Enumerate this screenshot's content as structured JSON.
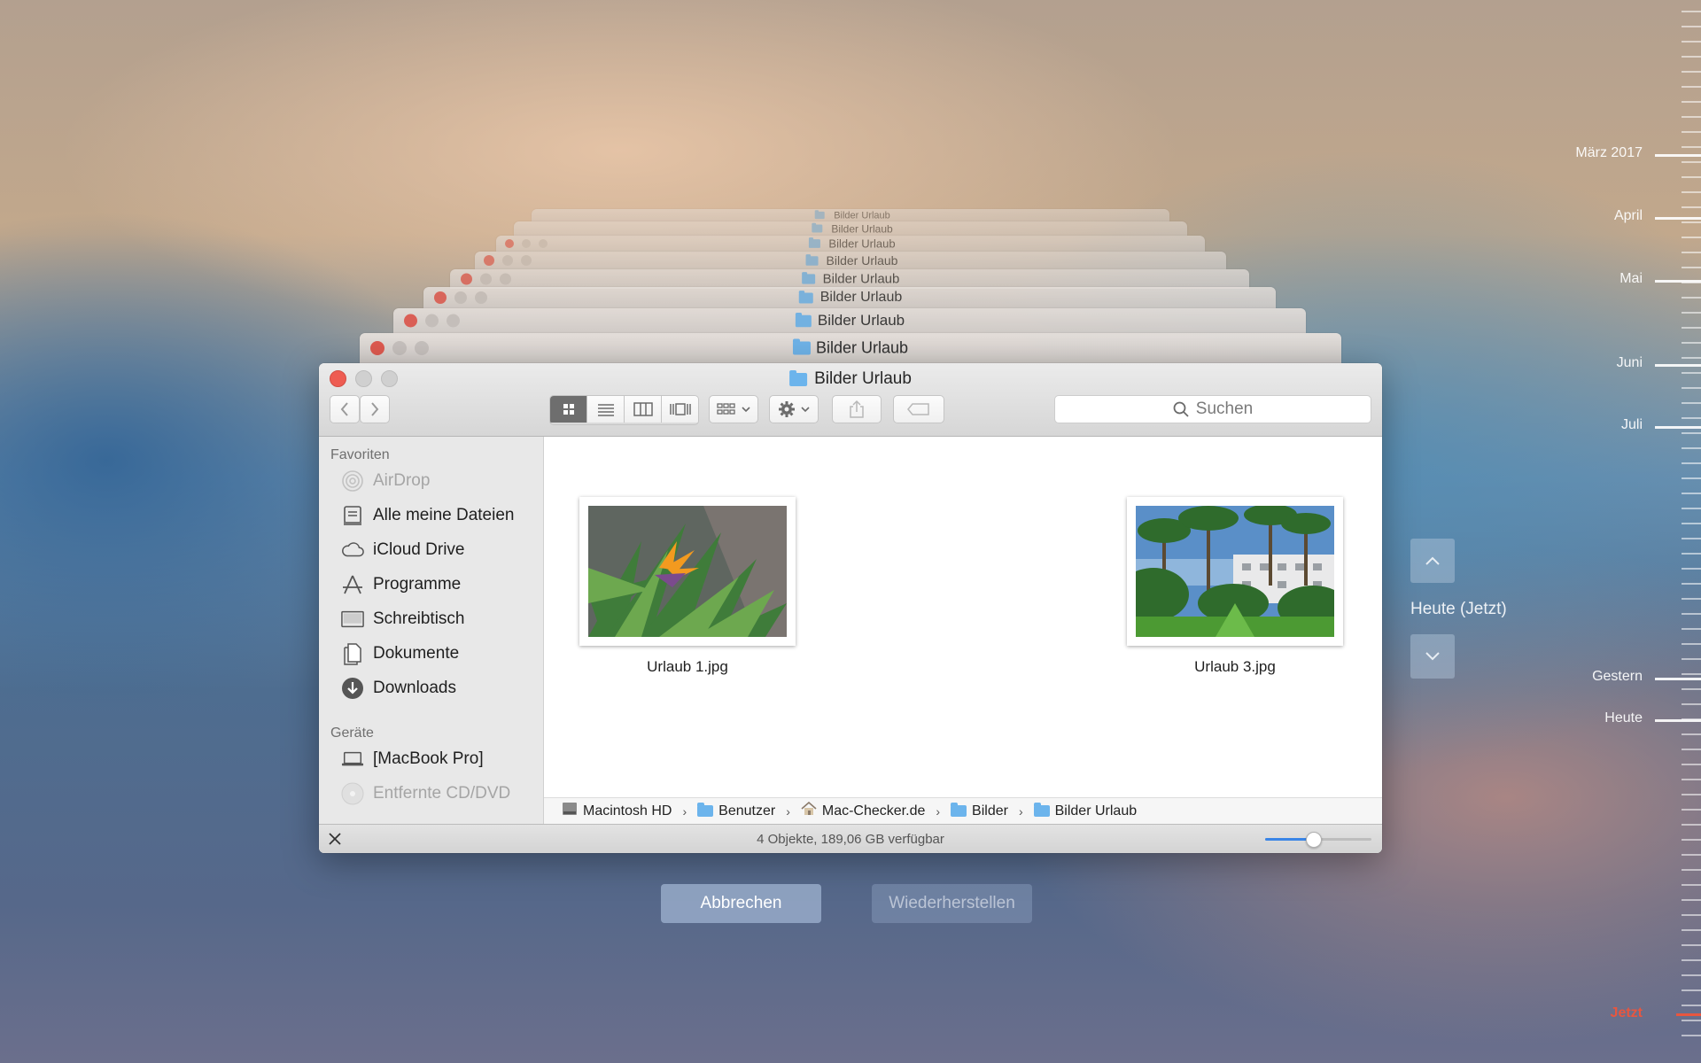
{
  "window": {
    "title": "Bilder Urlaub",
    "search_placeholder": "Suchen"
  },
  "sidebar": {
    "favorites_header": "Favoriten",
    "favorites": [
      {
        "label": "AirDrop",
        "icon": "airdrop-icon"
      },
      {
        "label": "Alle meine Dateien",
        "icon": "all-files-icon"
      },
      {
        "label": "iCloud Drive",
        "icon": "cloud-icon"
      },
      {
        "label": "Programme",
        "icon": "applications-icon"
      },
      {
        "label": "Schreibtisch",
        "icon": "desktop-icon"
      },
      {
        "label": "Dokumente",
        "icon": "documents-icon"
      },
      {
        "label": "Downloads",
        "icon": "downloads-icon"
      }
    ],
    "devices_header": "Geräte",
    "devices": [
      {
        "label": "[MacBook Pro]",
        "icon": "laptop-icon"
      },
      {
        "label": "Entfernte CD/DVD",
        "icon": "disc-icon"
      }
    ]
  },
  "files": [
    {
      "name": "Urlaub 1.jpg"
    },
    {
      "name": "Urlaub 3.jpg"
    }
  ],
  "pathbar": [
    "Macintosh HD",
    "Benutzer",
    "Mac-Checker.de",
    "Bilder",
    "Bilder Urlaub"
  ],
  "status": {
    "text": "4 Objekte, 189,06 GB verfügbar",
    "zoom_fraction": 0.45
  },
  "buttons": {
    "cancel": "Abbrechen",
    "restore": "Wiederherstellen"
  },
  "timemachine": {
    "current_label": "Heute (Jetzt)",
    "timeline": [
      "März 2017",
      "April",
      "Mai",
      "Juni",
      "Juli",
      "Gestern",
      "Heute",
      "Jetzt"
    ]
  },
  "colors": {
    "now_marker": "#e8563f",
    "accent": "#3a85e6"
  }
}
